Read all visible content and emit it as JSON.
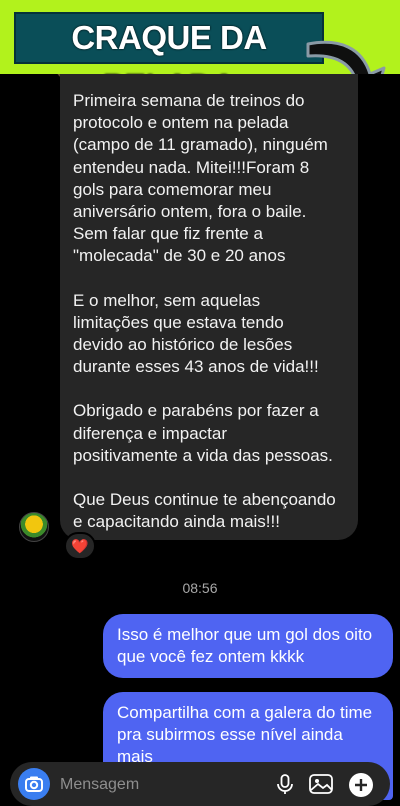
{
  "banner": {
    "title": "CRAQUE DA PELADA"
  },
  "incoming_message": {
    "paragraphs": [
      "Primeira semana de treinos do\nprotocolo e ontem na pelada\n(campo de 11 gramado), ninguém\nentendeu nada. Mitei!!!Foram 8\ngols para comemorar meu\naniversário ontem, fora o baile.\nSem falar que fiz frente a\n\"molecada\" de 30 e 20 anos",
      "E o melhor, sem aquelas\nlimitações que estava tendo\ndevido ao histórico de lesões\ndurante esses 43 anos de vida!!!",
      "Obrigado e parabéns por fazer a\ndiferença e impactar\npositivamente a vida das pessoas.",
      "Que Deus continue te abençoando\ne capacitando ainda mais!!!"
    ],
    "reaction": "❤️"
  },
  "timestamp": "08:56",
  "outgoing_messages": [
    "Isso é melhor que um gol dos oito\nque você fez ontem kkkk",
    "Compartilha com a galera do time\npra subirmos esse nível ainda\nmais"
  ],
  "composer": {
    "placeholder": "Mensagem"
  },
  "colors": {
    "banner_bg": "#b2f21c",
    "title_bg": "#0a4e58",
    "incoming_bubble": "#262626",
    "outgoing_bubble": "#4f64f2",
    "camera_button": "#3a7ef0"
  },
  "icons": [
    "arrow-down-icon",
    "camera-icon",
    "microphone-icon",
    "image-icon",
    "plus-icon",
    "heart-icon"
  ]
}
